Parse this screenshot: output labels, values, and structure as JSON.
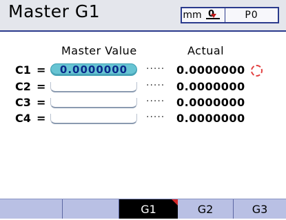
{
  "screen": {
    "title": "Master G1",
    "status": {
      "units": "mm",
      "datum_label": "0",
      "program": "P0"
    }
  },
  "table": {
    "headers": {
      "master": "Master Value",
      "actual": "Actual"
    },
    "dots": "·····",
    "rows": [
      {
        "label": "C1",
        "eq": "=",
        "master_value": "0.0000000",
        "actual": "0.0000000",
        "active": true
      },
      {
        "label": "C2",
        "eq": "=",
        "master_value": "",
        "actual": "0.0000000",
        "active": false
      },
      {
        "label": "C3",
        "eq": "=",
        "master_value": "",
        "actual": "0.0000000",
        "active": false
      },
      {
        "label": "C4",
        "eq": "=",
        "master_value": "",
        "actual": "0.0000000",
        "active": false
      }
    ]
  },
  "tabs": [
    {
      "label": "",
      "active": false
    },
    {
      "label": "",
      "active": false
    },
    {
      "label": "G1",
      "active": true
    },
    {
      "label": "G2",
      "active": false
    },
    {
      "label": "G3",
      "active": false
    }
  ],
  "colors": {
    "active_field": "#67c4d3",
    "tabbar": "#b9c0e4",
    "header_border": "#2a3a8c",
    "indicator": "#e24040",
    "tab_corner": "#d42828"
  },
  "icons": {
    "datum": "datum-zero-arrow-icon",
    "indicator": "dashed-circle-icon"
  }
}
